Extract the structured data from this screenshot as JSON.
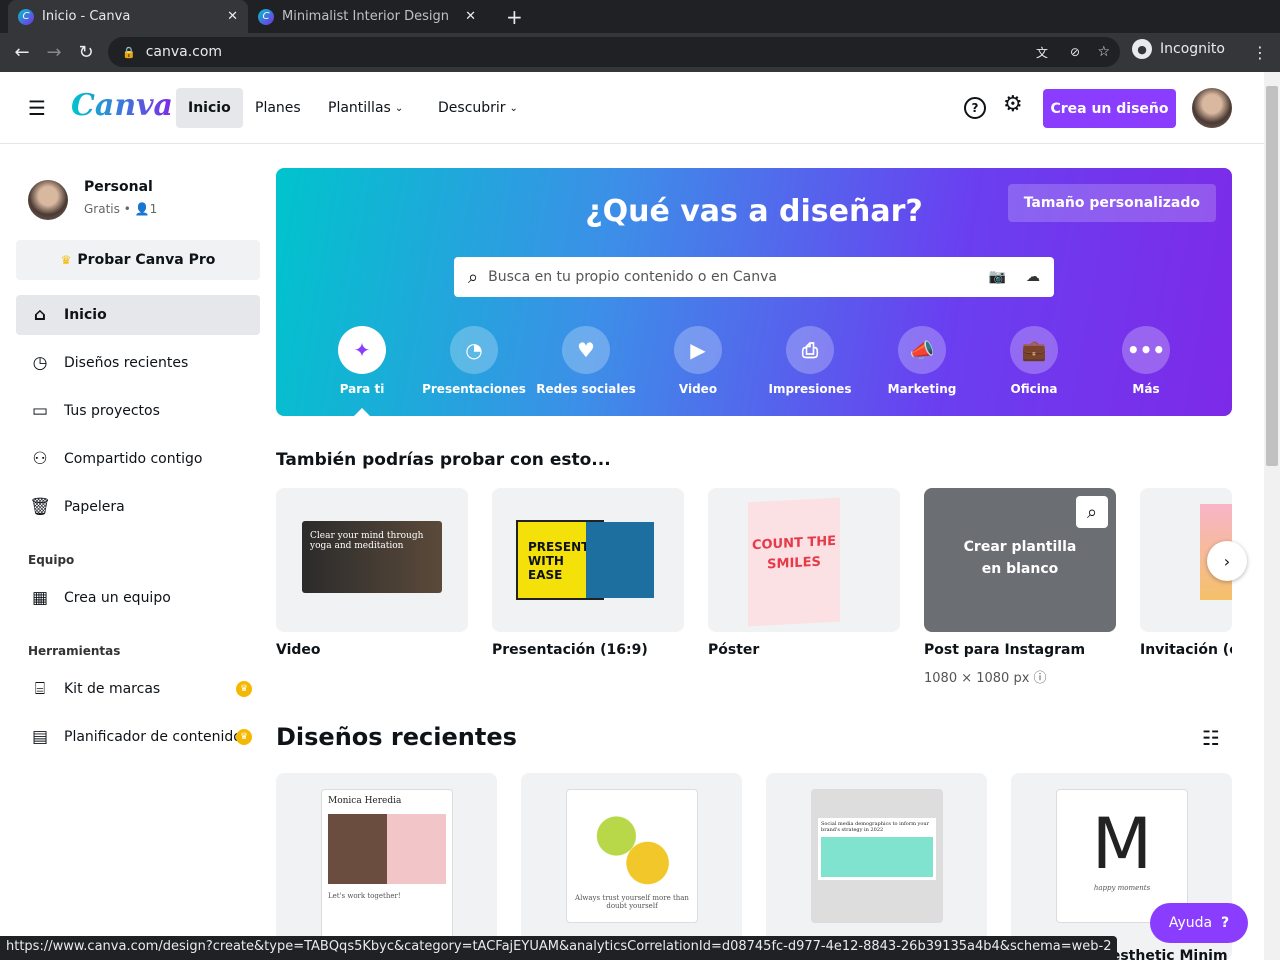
{
  "browser": {
    "tabs": [
      {
        "title": "Inicio - Canva"
      },
      {
        "title": "Minimalist Interior Design"
      }
    ],
    "url": "canva.com",
    "profile": "Incognito",
    "status_url": "https://www.canva.com/design?create&type=TABQqs5Kbyc&category=tACFajEYUAM&analyticsCorrelationId=d08745fc-d977-4e12-8843-26b39135a4b4&schema=web-2"
  },
  "header": {
    "logo": "Canva",
    "nav": [
      "Inicio",
      "Planes",
      "Plantillas",
      "Descubrir"
    ],
    "cta": "Crea un diseño"
  },
  "sidebar": {
    "account_name": "Personal",
    "account_plan": "Gratis",
    "members": "1",
    "pro_button": "Probar Canva Pro",
    "items": [
      "Inicio",
      "Diseños recientes",
      "Tus proyectos",
      "Compartido contigo",
      "Papelera"
    ],
    "team_section": "Equipo",
    "team_items": [
      "Crea un equipo"
    ],
    "tools_section": "Herramientas",
    "tools_items": [
      "Kit de marcas",
      "Planificador de contenido"
    ]
  },
  "hero": {
    "title": "¿Qué vas a diseñar?",
    "custom_size": "Tamaño personalizado",
    "search_placeholder": "Busca en tu propio contenido o en Canva",
    "categories": [
      "Para ti",
      "Presentaciones",
      "Redes sociales",
      "Video",
      "Impresiones",
      "Marketing",
      "Oficina",
      "Más"
    ]
  },
  "suggestions": {
    "title": "También podrías probar con esto...",
    "items": [
      {
        "label": "Video",
        "thumb": "Clear your mind through yoga and meditation"
      },
      {
        "label": "Presentación (16:9)",
        "thumb": "PRESENT WITH EASE"
      },
      {
        "label": "Póster",
        "thumb": "COUNT THE SMILES"
      },
      {
        "label": "Post para Instagram",
        "sub": "1080 × 1080 px",
        "overlay": "Crear plantilla en blanco"
      },
      {
        "label": "Invitación (cu"
      }
    ]
  },
  "recent": {
    "title": "Diseños recientes",
    "items": [
      {
        "thumb": "Monica Heredia",
        "sub": "Let's work together!"
      },
      {
        "thumb": "Always trust yourself more than doubt yourself"
      },
      {
        "thumb": "Social media demographics to inform your brand's strategy in 2022"
      },
      {
        "thumb": "happy moments"
      }
    ],
    "partial_label": "Aesthetic Minim"
  },
  "help": "Ayuda"
}
